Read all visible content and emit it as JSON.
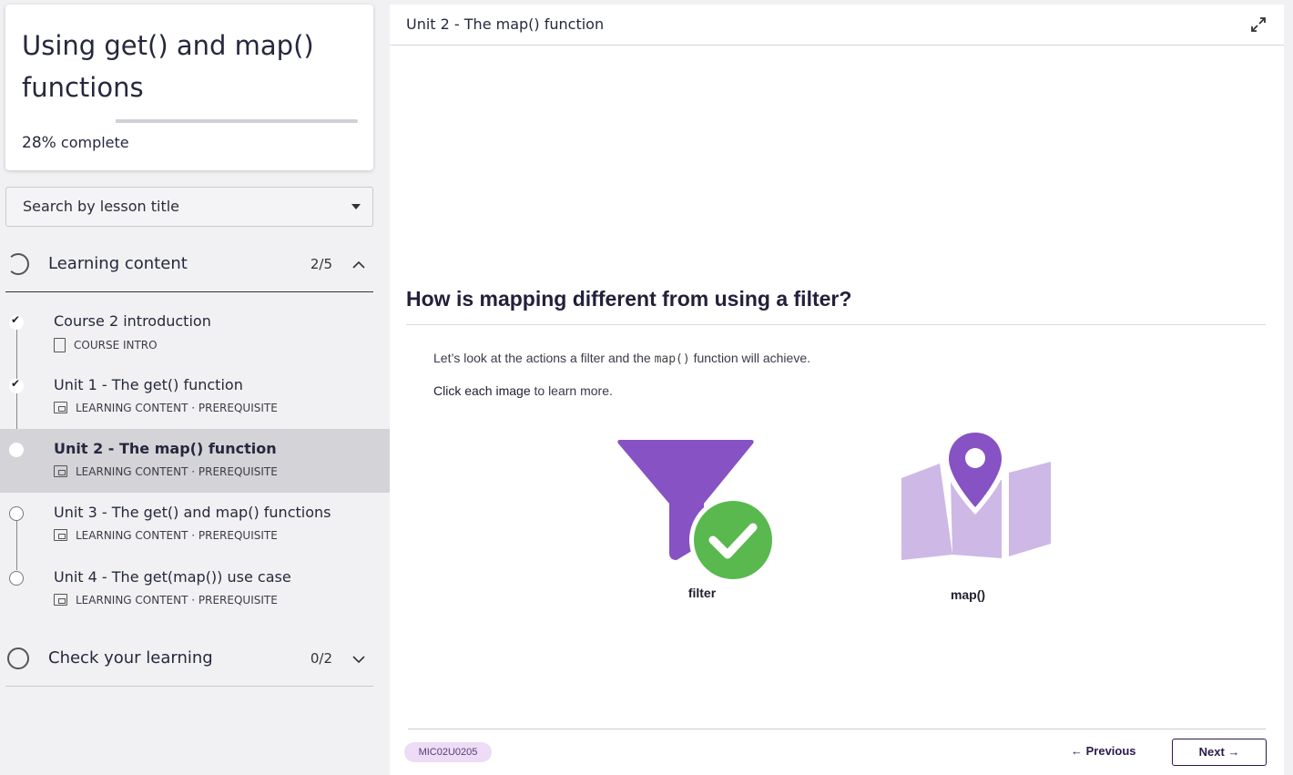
{
  "course": {
    "title": "Using get() and map() functions",
    "progress_percent": 28,
    "progress_pct_label": "28%",
    "progress_suffix": "complete"
  },
  "search": {
    "label": "Search by lesson title"
  },
  "sections": [
    {
      "title": "Learning content",
      "count": "2/5",
      "expanded": true,
      "lessons": [
        {
          "name": "Course 2 introduction",
          "type": "COURSE INTRO",
          "status": "done"
        },
        {
          "name": "Unit 1 - The get() function",
          "type": "LEARNING CONTENT · PREREQUISITE",
          "status": "done"
        },
        {
          "name": "Unit 2 - The map() function",
          "type": "LEARNING CONTENT · PREREQUISITE",
          "status": "current"
        },
        {
          "name": "Unit 3 - The get() and map() functions",
          "type": "LEARNING CONTENT · PREREQUISITE",
          "status": "todo"
        },
        {
          "name": "Unit 4 - The get(map()) use case",
          "type": "LEARNING CONTENT · PREREQUISITE",
          "status": "todo"
        }
      ]
    },
    {
      "title": "Check your learning",
      "count": "0/2",
      "expanded": false
    }
  ],
  "main": {
    "unit_title": "Unit 2 - The map() function",
    "question": "How is mapping different from using a filter?",
    "intro_before": "Let’s look at the actions a filter and the ",
    "intro_code": "map()",
    "intro_after": " function will achieve.",
    "click_strong": "Click each image",
    "click_rest": " to learn more.",
    "images": [
      {
        "label": "filter",
        "icon": "filter-check-icon"
      },
      {
        "label": "map()",
        "icon": "map-pin-icon"
      }
    ],
    "code": "MIC02U0205",
    "prev_label": "← Previous",
    "next_label": "Next →"
  },
  "colors": {
    "purple": "#8752c4",
    "light_purple": "#cdb8e6",
    "green": "#59b94e",
    "badge": "#ecdcf5"
  }
}
